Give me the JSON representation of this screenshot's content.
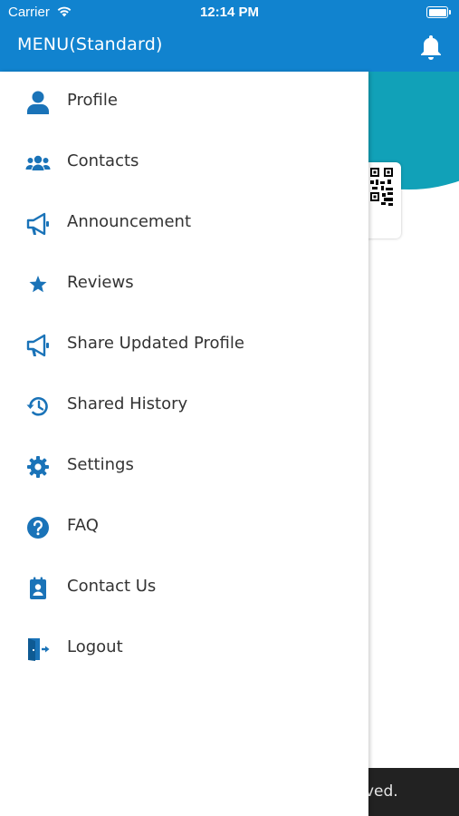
{
  "status_bar": {
    "carrier": "Carrier",
    "time": "12:14 PM"
  },
  "header": {
    "title": "MENU(Standard)"
  },
  "menu": {
    "items": [
      {
        "label": "Profile",
        "icon": "person-icon"
      },
      {
        "label": "Contacts",
        "icon": "users-icon"
      },
      {
        "label": "Announcement",
        "icon": "megaphone-icon"
      },
      {
        "label": "Reviews",
        "icon": "star-icon"
      },
      {
        "label": "Share Updated Profile",
        "icon": "megaphone-icon"
      },
      {
        "label": "Shared History",
        "icon": "history-icon"
      },
      {
        "label": "Settings",
        "icon": "gear-icon"
      },
      {
        "label": "FAQ",
        "icon": "question-icon"
      },
      {
        "label": "Contact Us",
        "icon": "contact-card-icon"
      },
      {
        "label": "Logout",
        "icon": "logout-icon"
      }
    ]
  },
  "background_page": {
    "footer_fragment": "ved."
  },
  "colors": {
    "primary": "#1183cf",
    "icon": "#1a73b8",
    "text": "#333333",
    "teal": "#11a1b8"
  }
}
